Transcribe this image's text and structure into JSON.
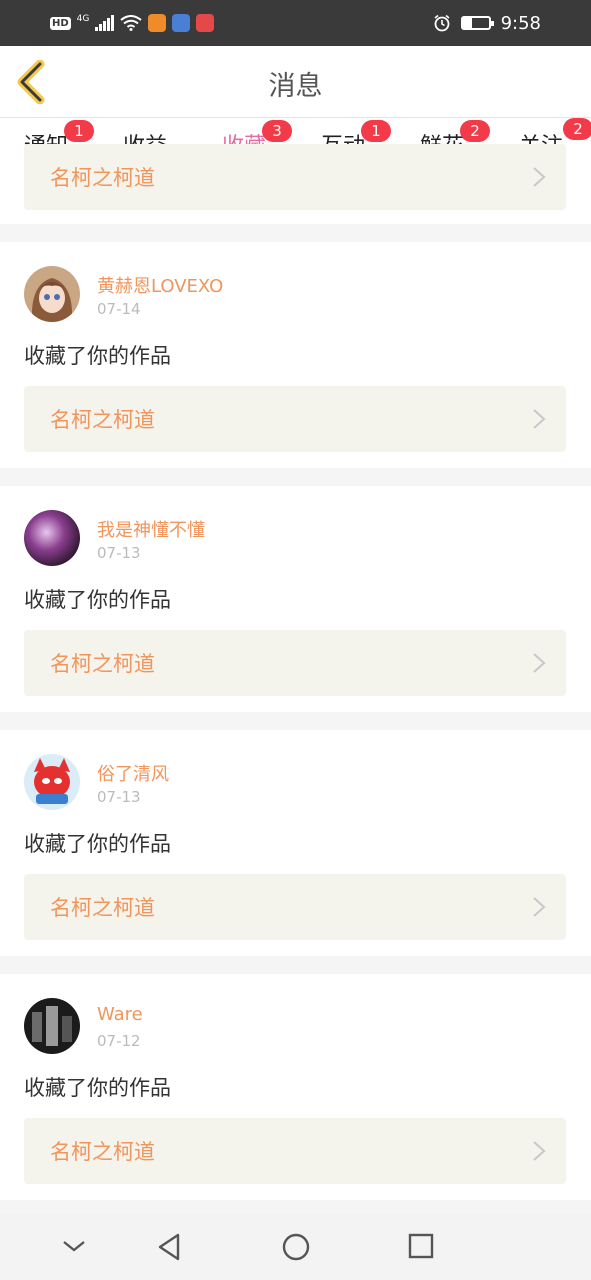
{
  "status_bar": {
    "time": "9:58",
    "network": "4G",
    "hd": "HD"
  },
  "header": {
    "title": "消息"
  },
  "tabs": [
    {
      "label": "通知",
      "badge": "1",
      "active": false
    },
    {
      "label": "收益",
      "badge": "",
      "active": false
    },
    {
      "label": "收藏",
      "badge": "3",
      "active": true
    },
    {
      "label": "互动",
      "badge": "1",
      "active": false
    },
    {
      "label": "鲜花",
      "badge": "2",
      "active": false
    },
    {
      "label": "关注",
      "badge": "2",
      "active": false
    }
  ],
  "partial_item": {
    "work_title": "名柯之柯道"
  },
  "items": [
    {
      "user": "黄赫恩LOVEXO",
      "date": "07-14",
      "action": "收藏了你的作品",
      "work_title": "名柯之柯道",
      "avatar_icon": "anime-girl-avatar"
    },
    {
      "user": "我是神懂不懂",
      "date": "07-13",
      "action": "收藏了你的作品",
      "work_title": "名柯之柯道",
      "avatar_icon": "purple-photo-avatar"
    },
    {
      "user": "俗了清风",
      "date": "07-13",
      "action": "收藏了你的作品",
      "work_title": "名柯之柯道",
      "avatar_icon": "red-cartoon-avatar"
    },
    {
      "user": "Ware",
      "date": "07-12",
      "action": "收藏了你的作品",
      "work_title": "名柯之柯道",
      "avatar_icon": "bw-photo-avatar"
    }
  ],
  "colors": {
    "accent": "#e26fa4",
    "username": "#f0955c",
    "badge": "#f23a48"
  }
}
